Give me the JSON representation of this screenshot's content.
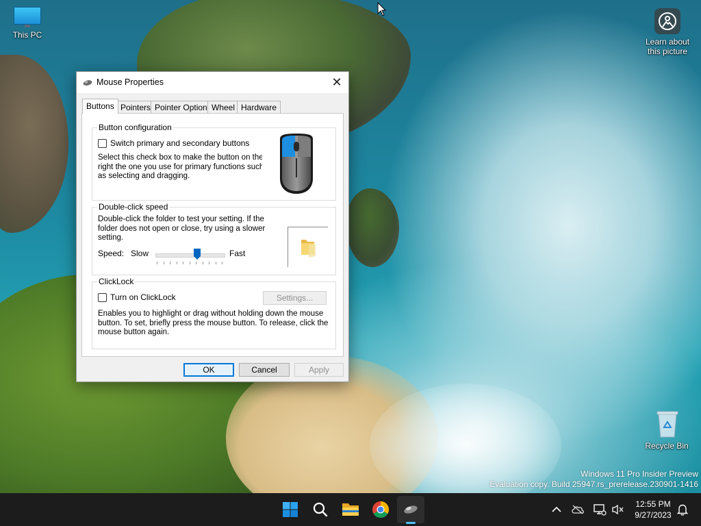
{
  "desktop": {
    "icons": {
      "this_pc": "This PC",
      "learn_line1": "Learn about",
      "learn_line2": "this picture",
      "recycle_bin": "Recycle Bin"
    },
    "watermark": {
      "line1": "Windows 11 Pro Insider Preview",
      "line2": "Evaluation copy. Build 25947.rs_prerelease.230901-1416"
    }
  },
  "dialog": {
    "title": "Mouse Properties",
    "close_glyph": "✕",
    "tabs": [
      "Buttons",
      "Pointers",
      "Pointer Options",
      "Wheel",
      "Hardware"
    ],
    "active_tab": "Buttons",
    "button_config": {
      "group_title": "Button configuration",
      "switch_label": "Switch primary and secondary buttons",
      "switch_checked": false,
      "desc_line1": "Select this check box to make the button on the",
      "desc_line2": "right the one you use for primary functions such",
      "desc_line3": "as selecting and dragging."
    },
    "double_click": {
      "group_title": "Double-click speed",
      "desc_line1": "Double-click the folder to test your setting. If the",
      "desc_line2": "folder does not open or close, try using a slower",
      "desc_line3": "setting.",
      "speed_label": "Speed:",
      "slow_label": "Slow",
      "fast_label": "Fast",
      "speed_value_fraction": 0.6
    },
    "clicklock": {
      "group_title": "ClickLock",
      "toggle_label": "Turn on ClickLock",
      "toggle_checked": false,
      "settings_button": "Settings...",
      "desc_line1": "Enables you to highlight or drag without holding down the mouse",
      "desc_line2": "button. To set, briefly press the mouse button. To release, click the",
      "desc_line3": "mouse button again."
    },
    "buttons": {
      "ok": "OK",
      "cancel": "Cancel",
      "apply": "Apply"
    }
  },
  "taskbar": {
    "apps": [
      "start-icon",
      "search-icon",
      "file-explorer-icon",
      "chrome-icon",
      "mouse-properties-icon"
    ],
    "clock_time": "12:55 PM",
    "clock_date": "9/27/2023"
  },
  "colors": {
    "accent": "#0078d7",
    "taskbar_bg": "#1c1c1c",
    "active_indicator": "#4cc2ff"
  }
}
